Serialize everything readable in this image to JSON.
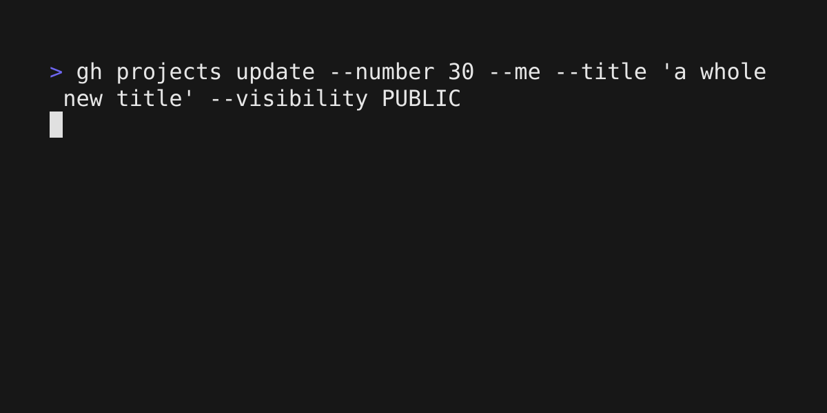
{
  "terminal": {
    "prompt_symbol": ">",
    "command_line_1": " gh projects update --number 30 --me --title 'a whole",
    "command_line_2": " new title' --visibility PUBLIC",
    "colors": {
      "background": "#171717",
      "text": "#e6e6e6",
      "prompt": "#6e66f0",
      "cursor": "#e0e0e0"
    }
  }
}
